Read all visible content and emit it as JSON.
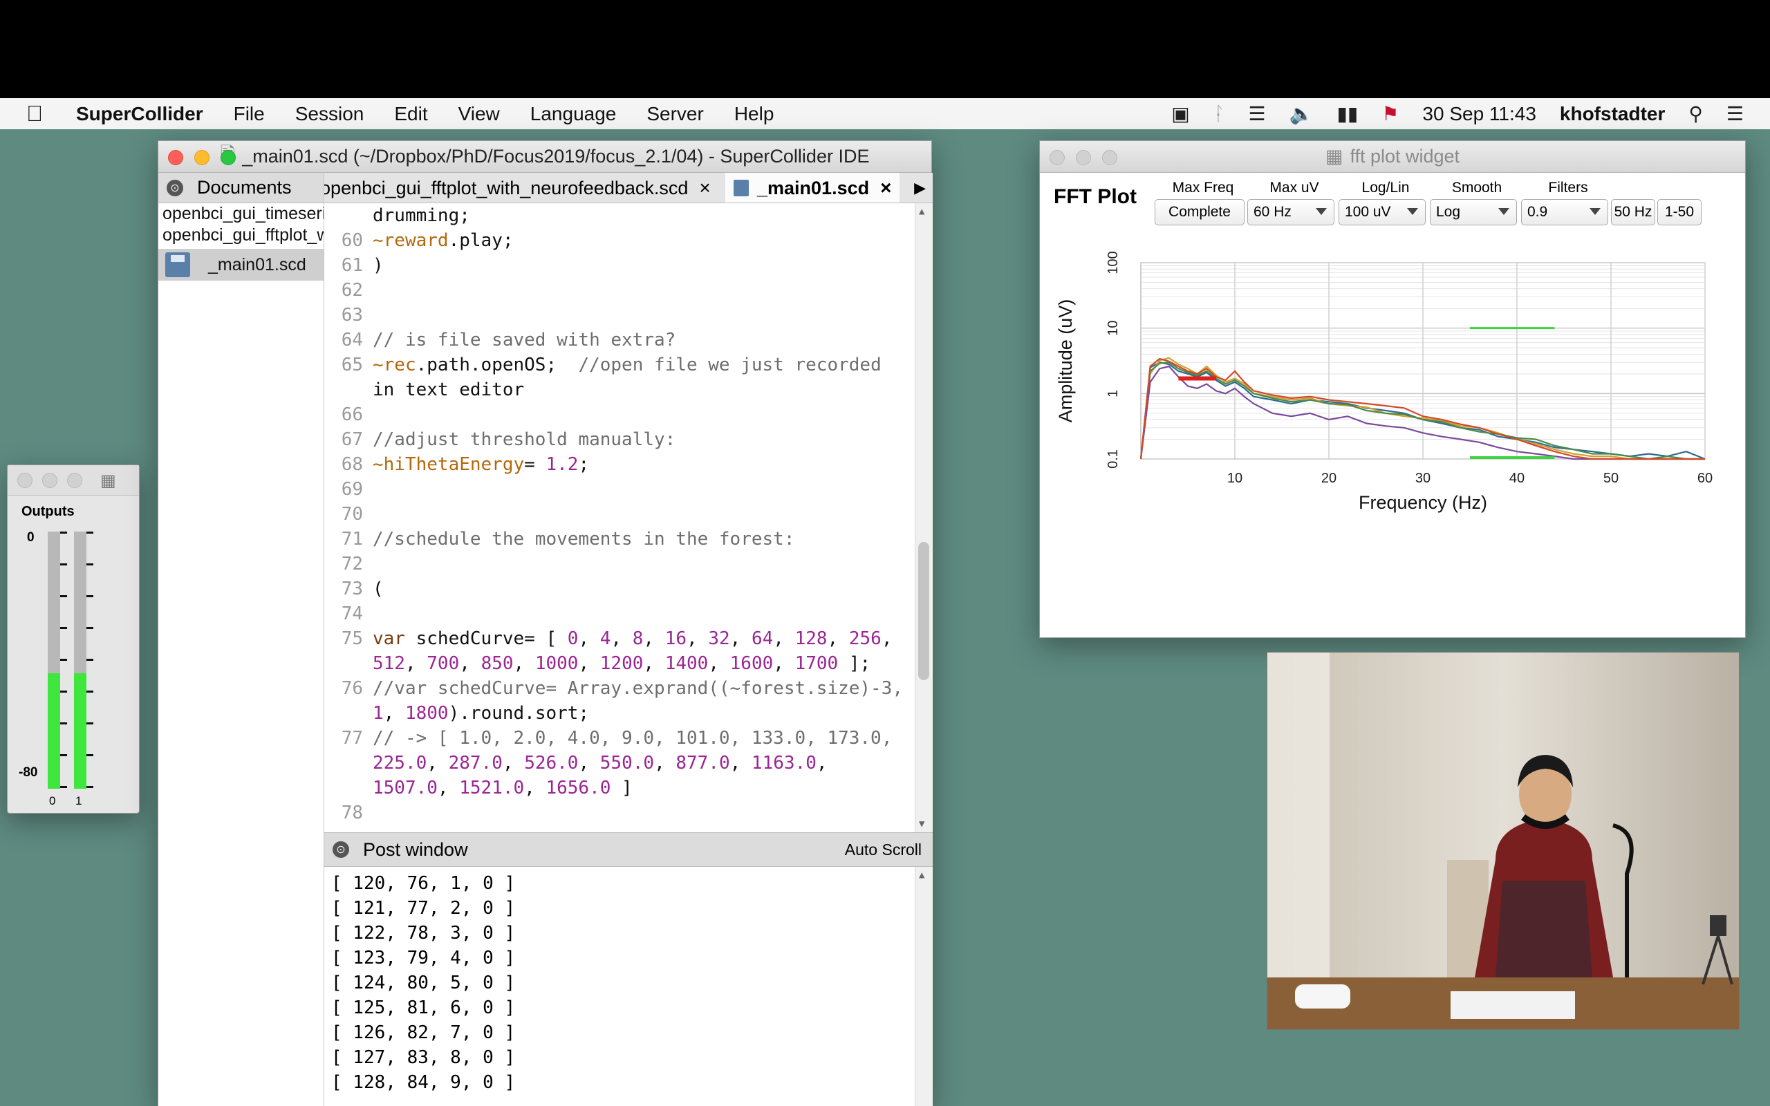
{
  "menubar": {
    "app_name": "SuperCollider",
    "items": [
      "File",
      "Session",
      "Edit",
      "View",
      "Language",
      "Server",
      "Help"
    ],
    "datetime": "30 Sep 11:43",
    "user": "khofstadter"
  },
  "ide": {
    "title": "_main01.scd (~/Dropbox/PhD/Focus2019/focus_2.1/04) - SuperCollider IDE",
    "documents_label": "Documents",
    "documents": [
      "openbci_gui_timeseri",
      "openbci_gui_fftplot_w",
      "_main01.scd"
    ],
    "tabs": [
      {
        "label": "openbci_gui_fftplot_with_neurofeedback.scd",
        "close": "×"
      },
      {
        "label": "_main01.scd",
        "close": "×"
      }
    ],
    "code_lines": [
      {
        "n": "",
        "t": "drumming;"
      },
      {
        "n": "60",
        "t": "~reward.play;"
      },
      {
        "n": "61",
        "t": ")"
      },
      {
        "n": "62",
        "t": ""
      },
      {
        "n": "63",
        "t": ""
      },
      {
        "n": "64",
        "t": "// is file saved with extra?"
      },
      {
        "n": "65",
        "t": "~rec.path.openOS;  //open file we just recorded"
      },
      {
        "n": "",
        "t": "in text editor"
      },
      {
        "n": "66",
        "t": ""
      },
      {
        "n": "67",
        "t": "//adjust threshold manually:"
      },
      {
        "n": "68",
        "t": "~hiThetaEnergy= 1.2;"
      },
      {
        "n": "69",
        "t": ""
      },
      {
        "n": "70",
        "t": ""
      },
      {
        "n": "71",
        "t": "//schedule the movements in the forest:"
      },
      {
        "n": "72",
        "t": ""
      },
      {
        "n": "73",
        "t": "("
      },
      {
        "n": "74",
        "t": ""
      },
      {
        "n": "75",
        "t": "var schedCurve= [ 0, 4, 8, 16, 32, 64, 128, 256,"
      },
      {
        "n": "",
        "t": "512, 700, 850, 1000, 1200, 1400, 1600, 1700 ];"
      },
      {
        "n": "76",
        "t": "//var schedCurve= Array.exprand((~forest.size)-3,"
      },
      {
        "n": "",
        "t": "1, 1800).round.sort;"
      },
      {
        "n": "77",
        "t": "// -> [ 1.0, 2.0, 4.0, 9.0, 101.0, 133.0, 173.0,"
      },
      {
        "n": "",
        "t": "225.0, 287.0, 526.0, 550.0, 877.0, 1163.0,"
      },
      {
        "n": "",
        "t": "1507.0, 1521.0, 1656.0 ]"
      },
      {
        "n": "78",
        "t": ""
      }
    ],
    "post_window_label": "Post window",
    "auto_scroll": "Auto Scroll",
    "post_lines": [
      "[ 120, 76, 1, 0 ]",
      "[ 121, 77, 2, 0 ]",
      "[ 122, 78, 3, 0 ]",
      "[ 123, 79, 4, 0 ]",
      "[ 124, 80, 5, 0 ]",
      "[ 125, 81, 6, 0 ]",
      "[ 126, 82, 7, 0 ]",
      "[ 127, 83, 8, 0 ]",
      "[ 128, 84, 9, 0 ]"
    ]
  },
  "outputs": {
    "title": "Outputs",
    "top_label": "0",
    "bottom_label": "-80",
    "channels": [
      "0",
      "1"
    ],
    "levels": [
      0.45,
      0.45
    ]
  },
  "fft": {
    "window_title": "fft plot widget",
    "title": "FFT Plot",
    "complete_button": "Complete",
    "controls": [
      {
        "label": "Max Freq",
        "value": "60 Hz"
      },
      {
        "label": "Max uV",
        "value": "100 uV"
      },
      {
        "label": "Log/Lin",
        "value": "Log"
      },
      {
        "label": "Smooth",
        "value": "0.9"
      }
    ],
    "filters_label": "Filters",
    "filter_buttons": [
      "50 Hz",
      "1-50"
    ]
  },
  "chart_data": {
    "type": "line",
    "title": "",
    "xlabel": "Frequency (Hz)",
    "ylabel": "Amplitude (uV)",
    "x_ticks": [
      "10",
      "20",
      "30",
      "40",
      "50",
      "60"
    ],
    "y_ticks": [
      "0.1",
      "1",
      "10",
      "100"
    ],
    "xlim": [
      0,
      60
    ],
    "ylim": [
      0.1,
      100
    ],
    "y_scale": "log",
    "grid": true,
    "series": [
      {
        "color": "#2f6c8f",
        "x": [
          0,
          1,
          2,
          3,
          4,
          5,
          6,
          7,
          8,
          9,
          10,
          11,
          12,
          14,
          16,
          18,
          20,
          22,
          24,
          26,
          28,
          30,
          32,
          34,
          36,
          38,
          40,
          42,
          44,
          46,
          48,
          50,
          52,
          54,
          56,
          58,
          60
        ],
        "values": [
          0.1,
          2.5,
          3,
          2.8,
          2.2,
          2,
          1.8,
          2.1,
          1.6,
          1.3,
          1.5,
          1.2,
          0.9,
          0.8,
          0.7,
          0.8,
          0.75,
          0.7,
          0.6,
          0.55,
          0.5,
          0.4,
          0.35,
          0.3,
          0.28,
          0.22,
          0.2,
          0.18,
          0.15,
          0.14,
          0.13,
          0.12,
          0.11,
          0.12,
          0.11,
          0.13,
          0.1
        ]
      },
      {
        "color": "#d4a032",
        "x": [
          0,
          1,
          2,
          3,
          4,
          5,
          6,
          7,
          8,
          9,
          10,
          11,
          12,
          14,
          16,
          18,
          20,
          22,
          24,
          26,
          28,
          30,
          32,
          34,
          36,
          38,
          40,
          42,
          44,
          46,
          48,
          50,
          52,
          54,
          56,
          58,
          60
        ],
        "values": [
          0.1,
          2,
          3.2,
          3.5,
          2.8,
          2.4,
          2,
          2.6,
          1.9,
          1.5,
          1.7,
          1.4,
          1,
          0.9,
          0.8,
          0.85,
          0.7,
          0.65,
          0.62,
          0.5,
          0.45,
          0.42,
          0.38,
          0.32,
          0.3,
          0.25,
          0.2,
          0.17,
          0.14,
          0.12,
          0.11,
          0.11,
          0.1,
          0.1,
          0.1,
          0.1,
          0.1
        ]
      },
      {
        "color": "#4a8a4a",
        "x": [
          0,
          1,
          2,
          3,
          4,
          5,
          6,
          7,
          8,
          9,
          10,
          11,
          12,
          14,
          16,
          18,
          20,
          22,
          24,
          26,
          28,
          30,
          32,
          34,
          36,
          38,
          40,
          42,
          44,
          46,
          48,
          50,
          52,
          54,
          56,
          58,
          60
        ],
        "values": [
          0.1,
          2.2,
          2.9,
          3,
          2.4,
          2.1,
          1.9,
          2.2,
          1.7,
          1.4,
          1.6,
          1.3,
          1,
          0.85,
          0.75,
          0.8,
          0.7,
          0.68,
          0.55,
          0.5,
          0.48,
          0.4,
          0.37,
          0.3,
          0.26,
          0.24,
          0.21,
          0.2,
          0.16,
          0.14,
          0.12,
          0.12,
          0.11,
          0.1,
          0.11,
          0.1,
          0.1
        ]
      },
      {
        "color": "#7a4a9a",
        "x": [
          0,
          1,
          2,
          3,
          4,
          5,
          6,
          7,
          8,
          9,
          10,
          11,
          12,
          14,
          16,
          18,
          20,
          22,
          24,
          26,
          28,
          30,
          32,
          34,
          36,
          38,
          40,
          42,
          44,
          46,
          48,
          50,
          52,
          54,
          56,
          58,
          60
        ],
        "values": [
          0.1,
          1.5,
          2.4,
          2.6,
          1.8,
          1.3,
          1.2,
          1.4,
          1.1,
          1,
          1.2,
          0.9,
          0.7,
          0.5,
          0.45,
          0.5,
          0.4,
          0.45,
          0.35,
          0.32,
          0.3,
          0.25,
          0.22,
          0.2,
          0.18,
          0.15,
          0.13,
          0.12,
          0.11,
          0.1,
          0.1,
          0.1,
          0.1,
          0.1,
          0.1,
          0.1,
          0.1
        ]
      },
      {
        "color": "#d04a2a",
        "x": [
          0,
          1,
          2,
          3,
          4,
          5,
          6,
          7,
          8,
          9,
          10,
          11,
          12,
          14,
          16,
          18,
          20,
          22,
          24,
          26,
          28,
          30,
          32,
          34,
          36,
          38,
          40,
          42,
          44,
          46,
          48,
          50,
          52,
          54,
          56,
          58,
          60
        ],
        "values": [
          0.1,
          2.6,
          3.4,
          3.1,
          2.6,
          2.2,
          2,
          2.4,
          1.8,
          1.6,
          2.2,
          1.5,
          1.1,
          0.95,
          0.85,
          0.9,
          0.8,
          0.75,
          0.7,
          0.65,
          0.6,
          0.45,
          0.4,
          0.34,
          0.3,
          0.24,
          0.2,
          0.16,
          0.13,
          0.11,
          0.1,
          0.1,
          0.1,
          0.1,
          0.1,
          0.1,
          0.1
        ]
      }
    ],
    "threshold_band": {
      "x": [
        4,
        8
      ],
      "value": 1.7,
      "color": "#e02020"
    },
    "reward_band": {
      "x": [
        35,
        44
      ],
      "value": 10,
      "color": "#3ed23e"
    }
  }
}
